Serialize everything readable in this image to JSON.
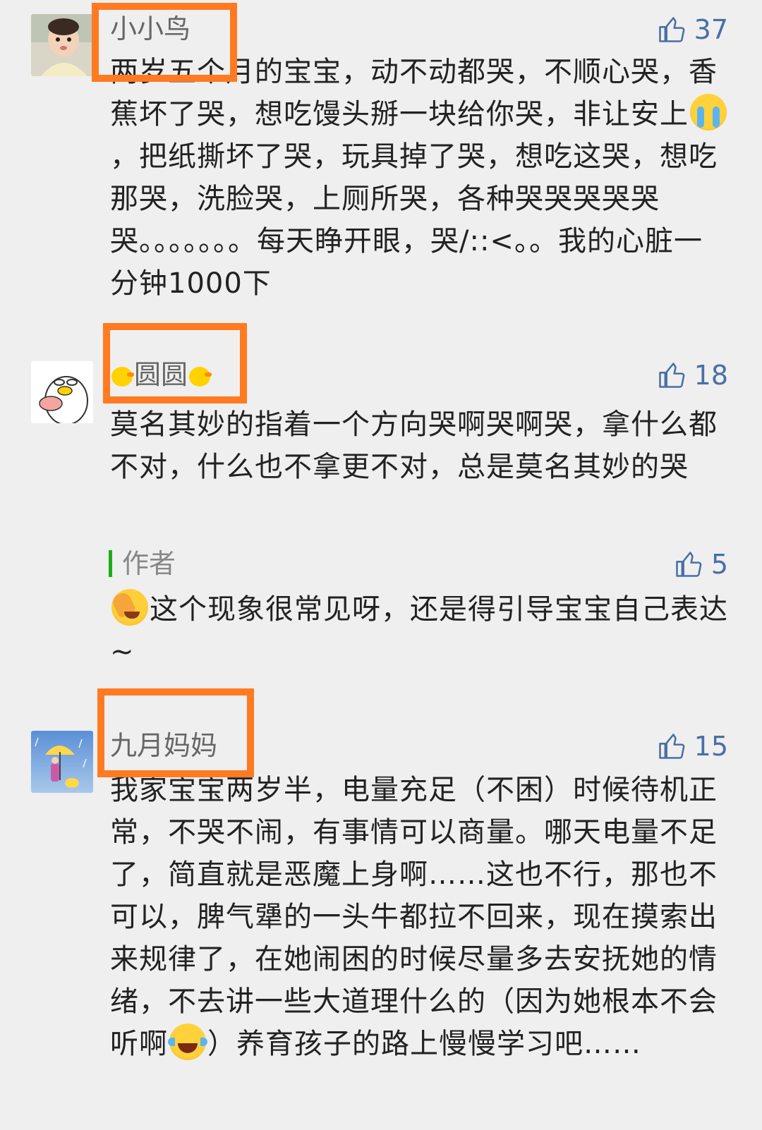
{
  "comments": [
    {
      "username": "小小鸟",
      "likes": "37",
      "content_parts": [
        "两岁五个月的宝宝，动不动都哭，不顺心哭，香蕉坏了哭，想吃馒头掰一块给你哭，非让安上",
        "，把纸撕坏了哭，玩具掉了哭，想吃这哭，想吃那哭，洗脸哭，上厕所哭，各种哭哭哭哭哭哭。。。。。。。每天睁开眼，哭/::<。。我的心脏一分钟1000下"
      ],
      "avatar_icon": "baby-photo-avatar"
    },
    {
      "username": "圆圆",
      "likes": "18",
      "content": "莫名其妙的指着一个方向哭啊哭啊哭，拿什么都不对，什么也不拿更不对，总是莫名其妙的哭",
      "avatar_icon": "cartoon-duck-avatar",
      "reply": {
        "author_label": "作者",
        "likes": "5",
        "content": "这个现象很常见呀，还是得引导宝宝自己表达~"
      }
    },
    {
      "username": "九月妈妈",
      "likes": "15",
      "content_parts": [
        "我家宝宝两岁半，电量充足（不困）时候待机正常，不哭不闹，有事情可以商量。哪天电量不足了，简直就是恶魔上身啊……这也不行，那也不可以，脾气犟的一头牛都拉不回来，现在摸索出来规律了，在她闹困的时候尽量多去安抚她的情绪，不去讲一些大道理什么的（因为她根本不会听啊",
        "）养育孩子的路上慢慢学习吧……"
      ],
      "avatar_icon": "rain-umbrella-avatar"
    }
  ],
  "colors": {
    "background": "#efefef",
    "highlight": "#ff7a20",
    "like": "#4a6fa5",
    "author_bar": "#1aad19"
  }
}
